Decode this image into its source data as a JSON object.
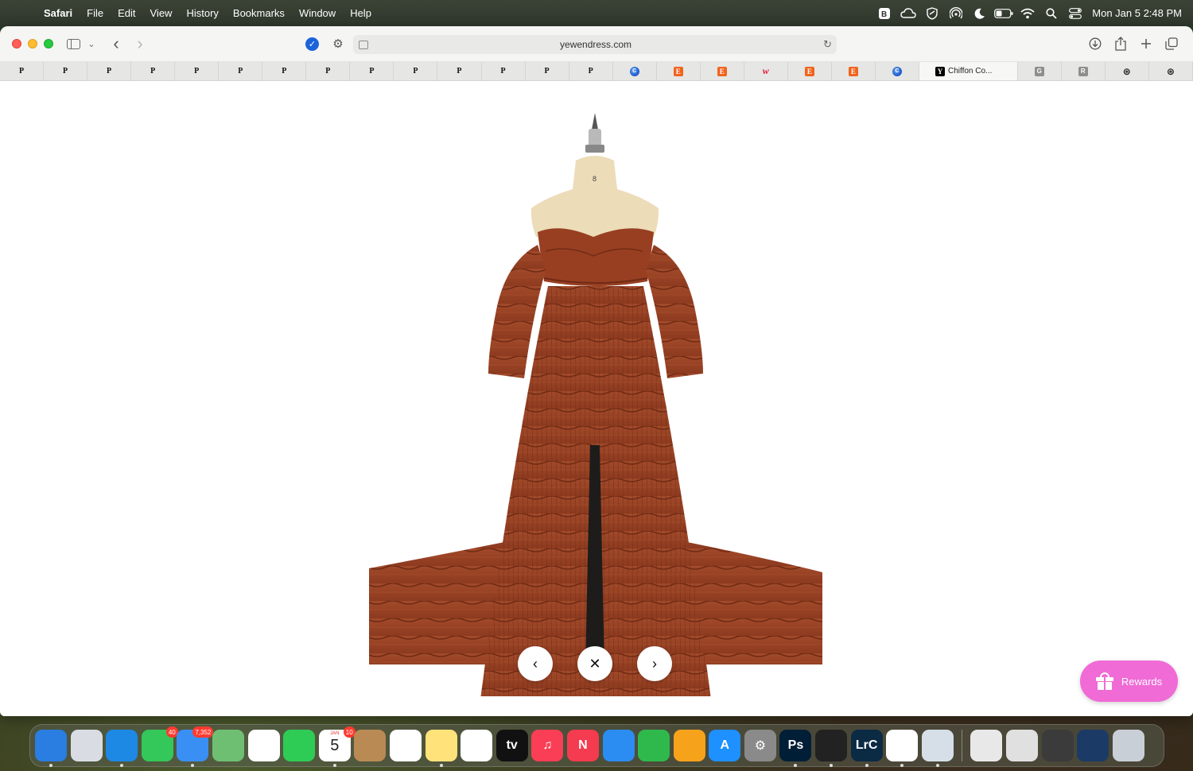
{
  "menubar": {
    "app_name": "Safari",
    "items": [
      "File",
      "Edit",
      "View",
      "History",
      "Bookmarks",
      "Window",
      "Help"
    ],
    "status_icons": [
      "bbedit-icon",
      "cloud-sync-icon",
      "vpn-shield-icon",
      "airdrop-icon",
      "focus-moon-icon",
      "battery-icon",
      "wifi-icon",
      "spotlight-search-icon",
      "control-center-icon"
    ],
    "clock": "Mon Jan 5  2:48 PM"
  },
  "toolbar": {
    "url": "yewendress.com",
    "buttons": [
      "sidebar",
      "tab-group-chevron",
      "back",
      "forward",
      "download",
      "share",
      "new-tab",
      "tab-overview"
    ]
  },
  "tabs": [
    {
      "favicon": "P",
      "type": "p"
    },
    {
      "favicon": "P",
      "type": "p"
    },
    {
      "favicon": "P",
      "type": "p"
    },
    {
      "favicon": "P",
      "type": "p"
    },
    {
      "favicon": "P",
      "type": "p"
    },
    {
      "favicon": "P",
      "type": "p"
    },
    {
      "favicon": "P",
      "type": "p"
    },
    {
      "favicon": "P",
      "type": "p"
    },
    {
      "favicon": "P",
      "type": "p"
    },
    {
      "favicon": "P",
      "type": "p"
    },
    {
      "favicon": "P",
      "type": "p"
    },
    {
      "favicon": "P",
      "type": "p"
    },
    {
      "favicon": "P",
      "type": "p"
    },
    {
      "favicon": "P",
      "type": "p"
    },
    {
      "favicon": "C",
      "type": "c"
    },
    {
      "favicon": "E",
      "type": "e"
    },
    {
      "favicon": "E",
      "type": "e"
    },
    {
      "favicon": "w",
      "type": "w"
    },
    {
      "favicon": "E",
      "type": "e"
    },
    {
      "favicon": "E",
      "type": "e"
    },
    {
      "favicon": "C",
      "type": "c"
    },
    {
      "favicon": "Y",
      "type": "y",
      "title": "Chiffon Co...",
      "active": true
    },
    {
      "favicon": "G",
      "type": "g"
    },
    {
      "favicon": "R",
      "type": "g"
    },
    {
      "favicon": "⊛",
      "type": "o"
    },
    {
      "favicon": "⊛",
      "type": "o"
    }
  ],
  "viewer": {
    "mannequin_size_label": "8",
    "prev_icon": "‹",
    "close_icon": "✕",
    "next_icon": "›"
  },
  "rewards": {
    "label": "Rewards"
  },
  "dock": {
    "apps": [
      {
        "name": "finder",
        "label": "",
        "bg": "#2a7de1"
      },
      {
        "name": "launchpad",
        "label": "",
        "bg": "#d9dde3"
      },
      {
        "name": "safari",
        "label": "",
        "bg": "#1e88e5"
      },
      {
        "name": "messages",
        "label": "",
        "bg": "#34c759",
        "badge": "40"
      },
      {
        "name": "mail",
        "label": "",
        "bg": "#3a8ff5",
        "badge": "7,352"
      },
      {
        "name": "maps",
        "label": "",
        "bg": "#6fbf73"
      },
      {
        "name": "photos",
        "label": "",
        "bg": "#ffffff"
      },
      {
        "name": "facetime",
        "label": "",
        "bg": "#2ecc55"
      },
      {
        "name": "calendar",
        "label": "5",
        "bg": "#ffffff",
        "badge": "10",
        "sub": "JAN"
      },
      {
        "name": "contacts",
        "label": "",
        "bg": "#b98a54"
      },
      {
        "name": "reminders",
        "label": "",
        "bg": "#ffffff"
      },
      {
        "name": "notes",
        "label": "",
        "bg": "#ffe27a"
      },
      {
        "name": "freeform",
        "label": "",
        "bg": "#ffffff"
      },
      {
        "name": "apple-tv",
        "label": "tv",
        "bg": "#111111"
      },
      {
        "name": "music",
        "label": "♫",
        "bg": "#fa3e55"
      },
      {
        "name": "news",
        "label": "N",
        "bg": "#f53b4f"
      },
      {
        "name": "keynote",
        "label": "",
        "bg": "#2b8cf2"
      },
      {
        "name": "numbers",
        "label": "",
        "bg": "#2fb94c"
      },
      {
        "name": "pages",
        "label": "",
        "bg": "#f7a21b"
      },
      {
        "name": "app-store",
        "label": "A",
        "bg": "#1e90ff"
      },
      {
        "name": "system-settings",
        "label": "⚙",
        "bg": "#8a8a8a"
      },
      {
        "name": "photoshop",
        "label": "Ps",
        "bg": "#001e36"
      },
      {
        "name": "sidekick",
        "label": "",
        "bg": "#222222"
      },
      {
        "name": "lightroom-classic",
        "label": "LrC",
        "bg": "#0b2a44"
      },
      {
        "name": "chrome",
        "label": "",
        "bg": "#ffffff"
      },
      {
        "name": "preview",
        "label": "",
        "bg": "#d6dfe8"
      }
    ],
    "recents": [
      {
        "name": "screenshot-doc-1",
        "bg": "#e8e8e8"
      },
      {
        "name": "screenshot-doc-2",
        "bg": "#e0e0e0"
      },
      {
        "name": "photoshop-doc-1",
        "bg": "#3b3b3b"
      },
      {
        "name": "photoshop-doc-2",
        "bg": "#1b3b66"
      },
      {
        "name": "trash",
        "bg": "#c9cfd6"
      }
    ]
  }
}
